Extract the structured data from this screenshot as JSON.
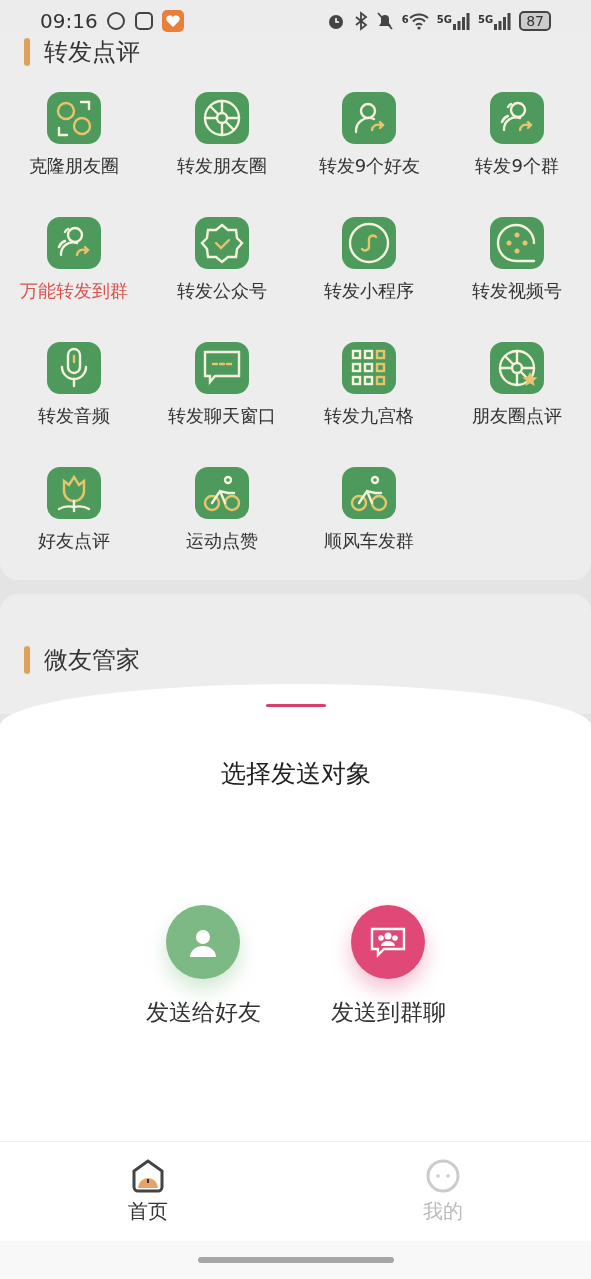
{
  "status_bar": {
    "time": "09:16",
    "battery": "87",
    "network_1": "5G",
    "network_2": "5G",
    "wifi_label": "6"
  },
  "section_1": {
    "title": "转发点评",
    "items": [
      {
        "label": "克隆朋友圈",
        "highlighted": false
      },
      {
        "label": "转发朋友圈",
        "highlighted": false
      },
      {
        "label": "转发9个好友",
        "highlighted": false
      },
      {
        "label": "转发9个群",
        "highlighted": false
      },
      {
        "label": "万能转发到群",
        "highlighted": true
      },
      {
        "label": "转发公众号",
        "highlighted": false
      },
      {
        "label": "转发小程序",
        "highlighted": false
      },
      {
        "label": "转发视频号",
        "highlighted": false
      },
      {
        "label": "转发音频",
        "highlighted": false
      },
      {
        "label": "转发聊天窗口",
        "highlighted": false
      },
      {
        "label": "转发九宫格",
        "highlighted": false
      },
      {
        "label": "朋友圈点评",
        "highlighted": false
      },
      {
        "label": "好友点评",
        "highlighted": false
      },
      {
        "label": "运动点赞",
        "highlighted": false
      },
      {
        "label": "顺风车发群",
        "highlighted": false
      }
    ]
  },
  "section_2": {
    "title": "微友管家"
  },
  "sheet": {
    "title": "选择发送对象",
    "options": [
      {
        "label": "发送给好友",
        "kind": "friend"
      },
      {
        "label": "发送到群聊",
        "kind": "group"
      }
    ]
  },
  "bottom_nav": [
    {
      "label": "首页",
      "selected": true
    },
    {
      "label": "我的",
      "selected": false
    }
  ]
}
